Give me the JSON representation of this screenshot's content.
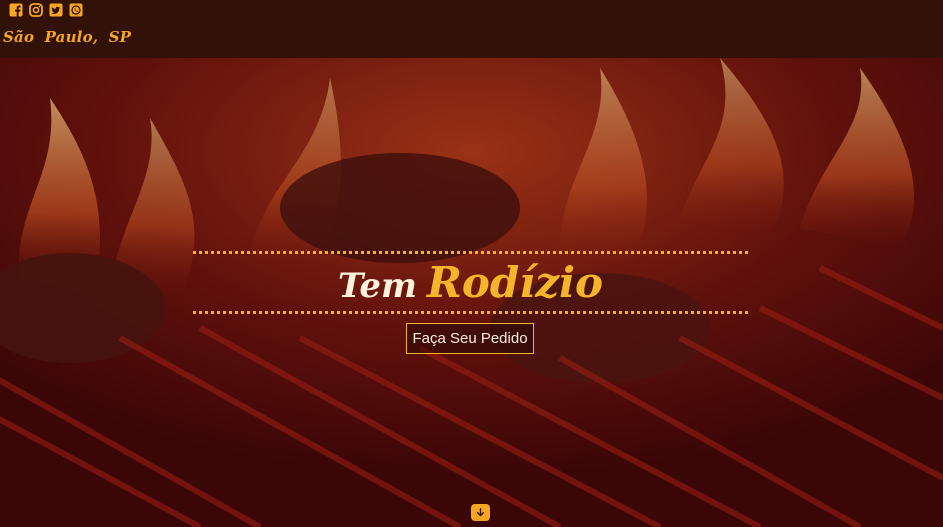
{
  "header": {
    "social_icons": [
      "facebook-icon",
      "instagram-icon",
      "twitter-icon",
      "whatsapp-icon"
    ],
    "location": "São Paulo, SP"
  },
  "hero": {
    "headline_part1": "Tem",
    "headline_part2": "Rodízio",
    "cta_label": "Faça Seu Pedido",
    "scroll_icon": "arrow-down-icon"
  },
  "colors": {
    "header_bg": "#321208",
    "accent": "#f5a623",
    "gold": "#f0b429",
    "headline_light": "#fdf2dc"
  }
}
